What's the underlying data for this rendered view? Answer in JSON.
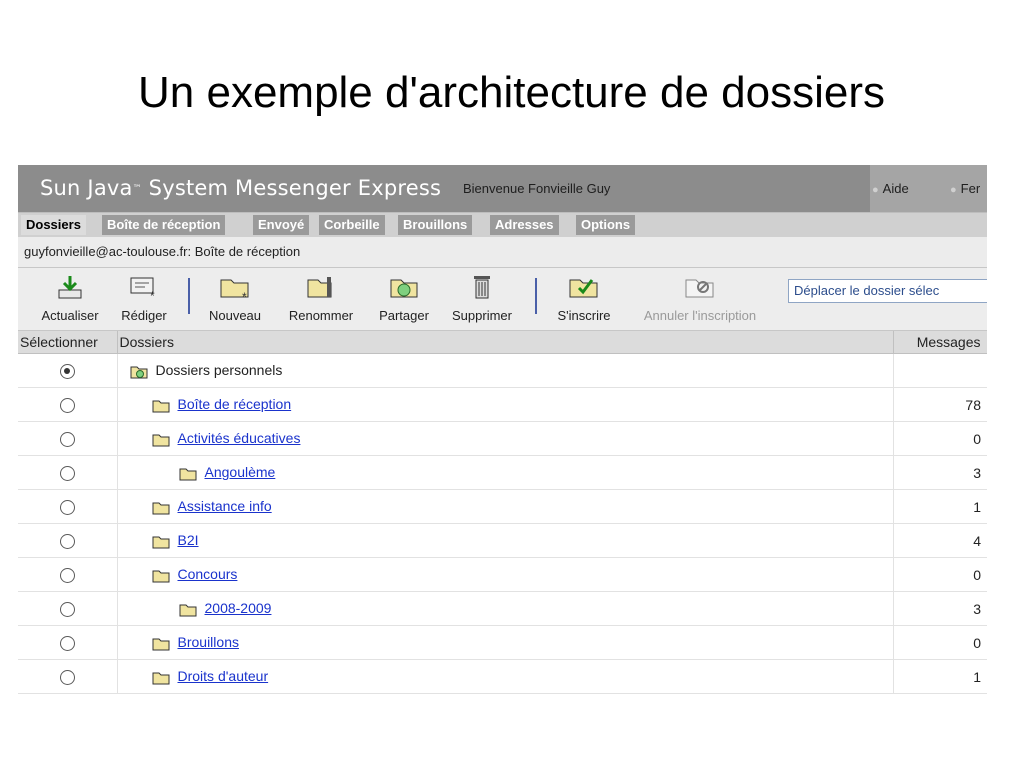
{
  "slide": {
    "title": "Un exemple d'architecture de dossiers"
  },
  "app": {
    "brand": "Sun Java",
    "brand_tm": "™",
    "brand_rest": " System Messenger Express",
    "welcome": "Bienvenue Fonvieille Guy",
    "links": [
      {
        "label": "Aide"
      },
      {
        "label": "Fer"
      }
    ]
  },
  "nav": {
    "tabs": [
      {
        "label": "Dossiers",
        "active": true
      },
      {
        "label": "Boîte de réception"
      },
      {
        "label": "Envoyé"
      },
      {
        "label": "Corbeille"
      },
      {
        "label": "Brouillons"
      },
      {
        "label": "Adresses"
      },
      {
        "label": "Options"
      }
    ]
  },
  "breadcrumb": "guyfonvieille@ac-toulouse.fr: Boîte de réception",
  "toolbar": {
    "buttons": [
      {
        "label": "Actualiser",
        "icon": "refresh-icon"
      },
      {
        "label": "Rédiger",
        "icon": "compose-icon"
      },
      {
        "label": "Nouveau",
        "icon": "new-folder-icon"
      },
      {
        "label": "Renommer",
        "icon": "rename-folder-icon"
      },
      {
        "label": "Partager",
        "icon": "share-folder-icon"
      },
      {
        "label": "Supprimer",
        "icon": "trash-icon"
      },
      {
        "label": "S'inscrire",
        "icon": "subscribe-icon"
      },
      {
        "label": "Annuler l'inscription",
        "icon": "unsubscribe-icon",
        "disabled": true
      }
    ],
    "move_select": "Déplacer le dossier sélec"
  },
  "table": {
    "headers": {
      "select": "Sélectionner",
      "folders": "Dossiers",
      "messages": "Messages"
    },
    "rows": [
      {
        "name": "Dossiers personnels",
        "count": "",
        "checked": true,
        "root": true
      },
      {
        "name": "Boîte de réception",
        "count": "78"
      },
      {
        "name": "Activités éducatives",
        "count": "0"
      },
      {
        "name": "Angoulème",
        "count": "3"
      },
      {
        "name": "Assistance info",
        "count": "1"
      },
      {
        "name": "B2I",
        "count": "4"
      },
      {
        "name": "Concours",
        "count": "0"
      },
      {
        "name": "2008-2009",
        "count": "3"
      },
      {
        "name": "Brouillons",
        "count": "0"
      },
      {
        "name": "Droits d'auteur",
        "count": "1"
      }
    ]
  },
  "colors": {
    "header_bg": "#8c8c8c",
    "tab_bg": "#9a9a9a",
    "link": "#1a33cc",
    "separator": "#4a5fa8"
  }
}
